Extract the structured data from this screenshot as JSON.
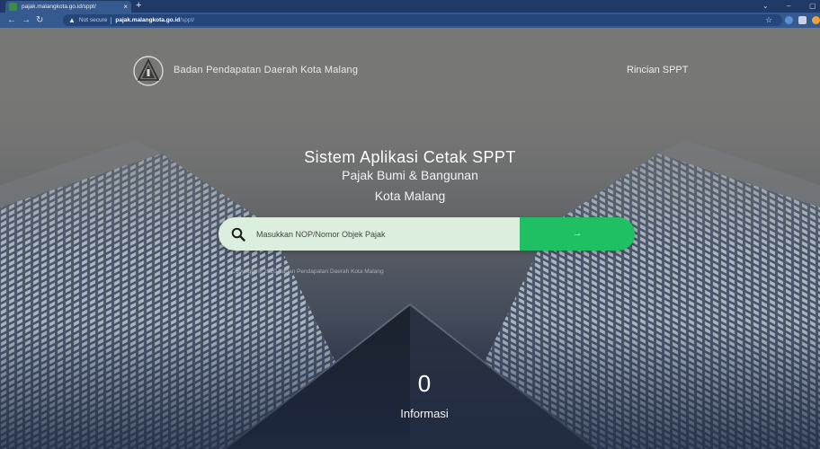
{
  "browser": {
    "tab_title": "pajak.malangkota.go.id/sppt/",
    "tab_close": "×",
    "new_tab": "+",
    "not_secure": "Not secure",
    "url_host": "pajak.malangkota.go.id",
    "url_path": "/sppt/"
  },
  "header": {
    "org_name": "Badan Pendapatan Daerah Kota Malang",
    "nav_link": "Rincian SPPT"
  },
  "hero": {
    "title": "Sistem Aplikasi Cetak SPPT",
    "subtitle1": "Pajak Bumi & Bangunan",
    "subtitle2": "Kota Malang"
  },
  "search": {
    "placeholder": "Masukkan NOP/Nomor Objek Pajak",
    "value": "",
    "button_label": "→"
  },
  "footer": {
    "copyright": "Copyright © 2020 Badan Pendapatan Daerah Kota Malang"
  },
  "info": {
    "count": "0",
    "label": "Informasi"
  },
  "colors": {
    "accent_green": "#1fbf64",
    "search_bg": "#dcefdf",
    "browser_chrome": "#355a8f"
  }
}
